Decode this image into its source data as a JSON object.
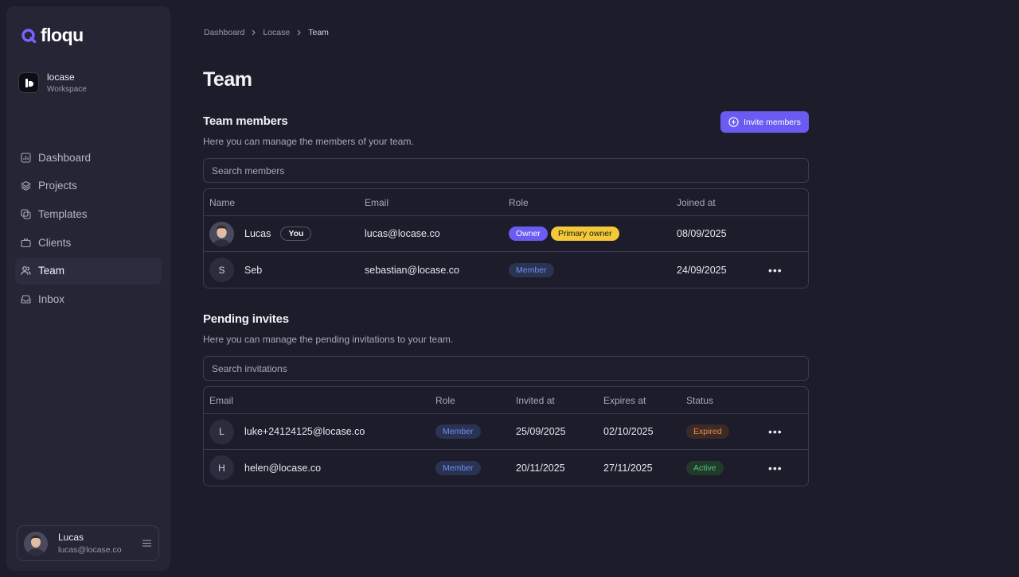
{
  "brand": {
    "name": "floqu",
    "color": "#7b61ff"
  },
  "workspace": {
    "name": "locase",
    "label": "Workspace"
  },
  "nav": [
    {
      "label": "Dashboard",
      "icon": "dashboard-icon"
    },
    {
      "label": "Projects",
      "icon": "layers-icon"
    },
    {
      "label": "Templates",
      "icon": "templates-icon"
    },
    {
      "label": "Clients",
      "icon": "briefcase-icon"
    },
    {
      "label": "Team",
      "icon": "users-icon",
      "active": true
    },
    {
      "label": "Inbox",
      "icon": "inbox-icon"
    }
  ],
  "user": {
    "name": "Lucas",
    "email": "lucas@locase.co"
  },
  "breadcrumb": [
    "Dashboard",
    "Locase",
    "Team"
  ],
  "page_title": "Team",
  "members": {
    "title": "Team members",
    "description": "Here you can manage the members of your team.",
    "invite_label": "Invite members",
    "search_placeholder": "Search members",
    "columns": [
      "Name",
      "Email",
      "Role",
      "Joined at"
    ],
    "rows": [
      {
        "name": "Lucas",
        "you_badge": "You",
        "email": "lucas@locase.co",
        "roles": [
          "Owner",
          "Primary owner"
        ],
        "joined": "08/09/2025"
      },
      {
        "name": "Seb",
        "initial": "S",
        "email": "sebastian@locase.co",
        "roles": [
          "Member"
        ],
        "joined": "24/09/2025"
      }
    ]
  },
  "invites": {
    "title": "Pending invites",
    "description": "Here you can manage the pending invitations to your team.",
    "search_placeholder": "Search invitations",
    "columns": [
      "Email",
      "Role",
      "Invited at",
      "Expires at",
      "Status"
    ],
    "rows": [
      {
        "initial": "L",
        "email": "luke+24124125@locase.co",
        "role": "Member",
        "invited": "25/09/2025",
        "expires": "02/10/2025",
        "status": "Expired"
      },
      {
        "initial": "H",
        "email": "helen@locase.co",
        "role": "Member",
        "invited": "20/11/2025",
        "expires": "27/11/2025",
        "status": "Active"
      }
    ]
  },
  "colors": {
    "accent": "#6a5cf2",
    "primary_owner": "#f3c839",
    "expired": "#e98b4d",
    "active": "#4fc476",
    "member": "#6f8df0"
  }
}
